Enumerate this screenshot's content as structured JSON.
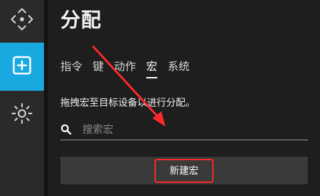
{
  "sidebar": {
    "items": [
      {
        "icon": "move-icon"
      },
      {
        "icon": "add-icon",
        "active": true,
        "accent": "#19a9e0"
      },
      {
        "icon": "brightness-icon"
      }
    ]
  },
  "panel": {
    "title": "分配",
    "tabs": [
      "指令",
      "键",
      "动作",
      "宏",
      "系统"
    ],
    "active_tab": "宏",
    "instruction": "拖拽宏至目标设备以进行分配。",
    "search": {
      "placeholder": "搜索宏",
      "value": ""
    },
    "new_macro_label": "新建宏"
  },
  "annotation": {
    "color": "#ff2a2a"
  }
}
